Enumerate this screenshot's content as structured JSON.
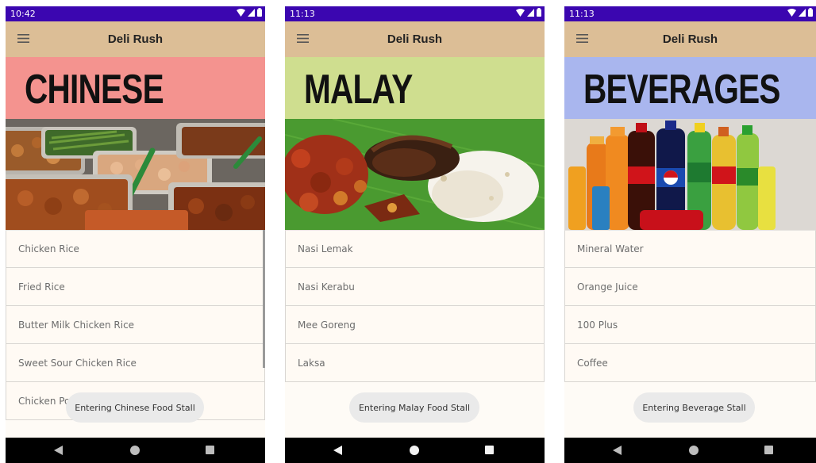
{
  "app": {
    "title": "Deli Rush"
  },
  "screens": [
    {
      "time": "10:42",
      "category": "CHINESE",
      "banner_color": "#f4938f",
      "photo": "chinese-food-trays",
      "items": [
        "Chicken Rice",
        "Fried Rice",
        "Butter Milk Chicken Rice",
        "Sweet Sour Chicken Rice",
        "Chicken Po"
      ],
      "toast": "Entering Chinese Food Stall"
    },
    {
      "time": "11:13",
      "category": "MALAY",
      "banner_color": "#cfde8f",
      "photo": "nasi-lemak-plate",
      "items": [
        "Nasi Lemak",
        "Nasi Kerabu",
        "Mee Goreng",
        "Laksa"
      ],
      "toast": "Entering Malay Food Stall"
    },
    {
      "time": "11:13",
      "category": "BEVERAGES",
      "banner_color": "#a9b6ee",
      "photo": "soft-drink-bottles",
      "items": [
        "Mineral Water",
        "Orange Juice",
        "100 Plus",
        "Coffee"
      ],
      "toast": "Entering Beverage Stall"
    }
  ],
  "colors": {
    "status_bar": "#3b06b0",
    "app_bar": "#dcbe96",
    "list_background": "#fffaf4",
    "nav_bar": "#000000"
  }
}
